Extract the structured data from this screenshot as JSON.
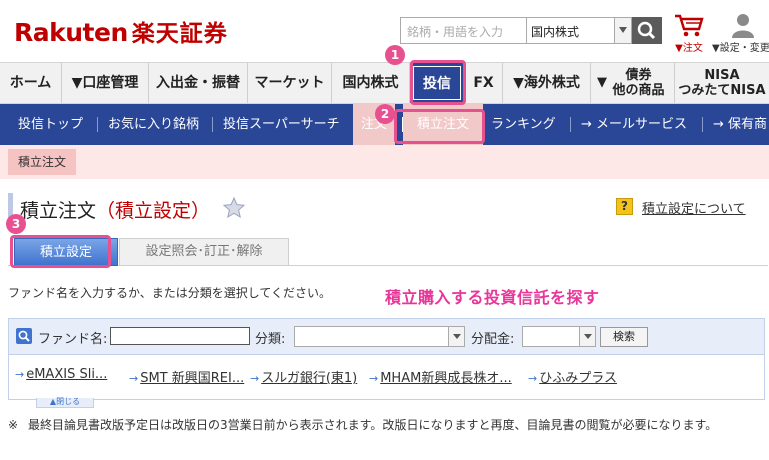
{
  "header": {
    "logo_latin": "Rakuten",
    "logo_jp": "楽天証券",
    "search_placeholder": "銘柄・用語を入力",
    "search_scope": "国内株式",
    "cart_label": "▼注文",
    "user_label": "▼設定・変更"
  },
  "global_nav": [
    {
      "label": "ホーム"
    },
    {
      "label": "▼口座管理"
    },
    {
      "label": "入出金・振替"
    },
    {
      "label": "マーケット"
    },
    {
      "label": "国内株式"
    },
    {
      "label": "投信"
    },
    {
      "label": "FX"
    },
    {
      "label": "▼海外株式"
    },
    {
      "label": "▼",
      "line1": "債券",
      "line2": "他の商品"
    },
    {
      "line1": "NISA",
      "line2": "つみたてNISA"
    }
  ],
  "sub_nav": [
    {
      "label": "投信トップ"
    },
    {
      "label": "お気に入り銘柄"
    },
    {
      "label": "投信スーパーサーチ"
    },
    {
      "label": "注文"
    },
    {
      "label": "積立注文"
    },
    {
      "label": "ランキング"
    },
    {
      "label": "→ メールサービス"
    },
    {
      "label": "→ 保有商"
    }
  ],
  "breadcrumb": "積立注文",
  "page": {
    "title_main": "積立注文",
    "title_sub": "（積立設定）",
    "help_link": "積立設定について"
  },
  "tabs": [
    {
      "label": "積立設定"
    },
    {
      "label": "設定照会･訂正･解除"
    }
  ],
  "instruction": "ファンド名を入力するか、または分類を選択してください。",
  "callout_text": "積立購入する投資信託を探す",
  "fund_search": {
    "fund_name_label": "ファンド名:",
    "category_label": "分類:",
    "distribution_label": "分配金:",
    "search_button": "検索",
    "close_button": "▲閉じる"
  },
  "recent_funds": [
    "eMAXIS Sli...",
    "SMT 新興国REI...",
    "スルガ銀行(東1)",
    "MHAM新興成長株オ...",
    "ひふみプラス"
  ],
  "note": {
    "mark": "※",
    "text": "最終目論見書改版予定日は改版日の3営業日前から表示されます。改版日になりますと再度、目論見書の閲覧が必要になります。"
  },
  "step_badges": [
    "1",
    "2",
    "3"
  ],
  "colors": {
    "brand_red": "#bf0000",
    "nav_blue": "#2a4697",
    "highlight_pink": "#e8518f"
  }
}
